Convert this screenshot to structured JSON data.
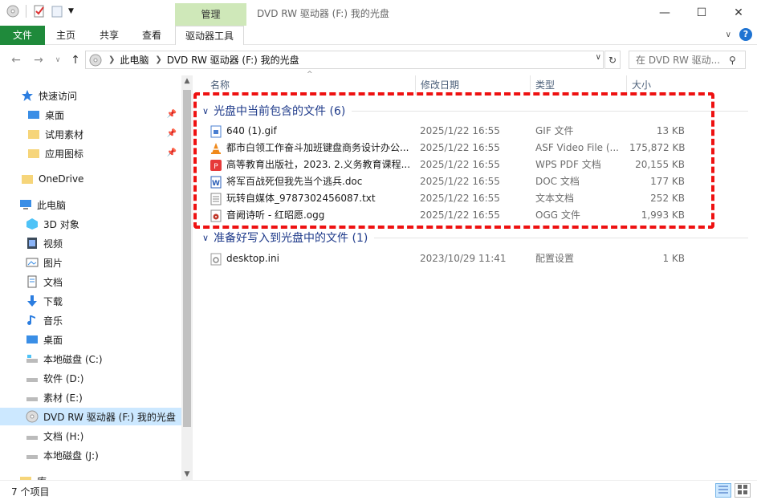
{
  "window": {
    "title": "DVD RW 驱动器 (F:) 我的光盘",
    "context_tab": "管理"
  },
  "ribbon": {
    "tabs": [
      {
        "label": "文件"
      },
      {
        "label": "主页"
      },
      {
        "label": "共享"
      },
      {
        "label": "查看"
      },
      {
        "label": "驱动器工具"
      }
    ]
  },
  "address": {
    "crumbs": [
      "此电脑",
      "DVD RW 驱动器 (F:) 我的光盘"
    ],
    "search_placeholder": "在 DVD RW 驱动..."
  },
  "sidebar": {
    "items": [
      {
        "label": "快速访问",
        "icon": "star-icon"
      },
      {
        "label": "桌面",
        "icon": "desktop-icon",
        "pinned": true
      },
      {
        "label": "试用素材",
        "icon": "folder-icon",
        "pinned": true
      },
      {
        "label": "应用图标",
        "icon": "folder-icon",
        "pinned": true
      },
      {
        "label": "OneDrive",
        "icon": "folder-icon"
      },
      {
        "label": "此电脑",
        "icon": "computer-icon"
      },
      {
        "label": "3D 对象",
        "icon": "cube-icon"
      },
      {
        "label": "视频",
        "icon": "video-icon"
      },
      {
        "label": "图片",
        "icon": "pictures-icon"
      },
      {
        "label": "文档",
        "icon": "document-icon"
      },
      {
        "label": "下载",
        "icon": "download-icon"
      },
      {
        "label": "音乐",
        "icon": "music-icon"
      },
      {
        "label": "桌面",
        "icon": "desktop-icon"
      },
      {
        "label": "本地磁盘 (C:)",
        "icon": "drive-icon"
      },
      {
        "label": "软件 (D:)",
        "icon": "drive-icon"
      },
      {
        "label": "素材 (E:)",
        "icon": "drive-icon"
      },
      {
        "label": "DVD RW 驱动器 (F:) 我的光盘",
        "icon": "disc-icon",
        "selected": true
      },
      {
        "label": "文档 (H:)",
        "icon": "drive-icon"
      },
      {
        "label": "本地磁盘 (J:)",
        "icon": "drive-icon"
      },
      {
        "label": "库",
        "icon": "library-icon"
      }
    ]
  },
  "columns": {
    "name": "名称",
    "date": "修改日期",
    "type": "类型",
    "size": "大小"
  },
  "groups": [
    {
      "title": "光盘中当前包含的文件 (6)",
      "files": [
        {
          "name": "640 (1).gif",
          "date": "2025/1/22 16:55",
          "type": "GIF 文件",
          "size": "13 KB",
          "icon": "gif-file-icon"
        },
        {
          "name": "都市白领工作奋斗加班键盘商务设计办公...",
          "date": "2025/1/22 16:55",
          "type": "ASF Video File (...",
          "size": "175,872 KB",
          "icon": "vlc-cone-icon"
        },
        {
          "name": "高等教育出版社，2023. 2.义务教育课程...",
          "date": "2025/1/22 16:55",
          "type": "WPS PDF 文档",
          "size": "20,155 KB",
          "icon": "pdf-file-icon"
        },
        {
          "name": "将军百战死但我先当个逃兵.doc",
          "date": "2025/1/22 16:55",
          "type": "DOC 文档",
          "size": "177 KB",
          "icon": "word-file-icon"
        },
        {
          "name": "玩转自媒体_9787302456087.txt",
          "date": "2025/1/22 16:55",
          "type": "文本文档",
          "size": "252 KB",
          "icon": "text-file-icon"
        },
        {
          "name": "音阙诗听 - 红昭愿.ogg",
          "date": "2025/1/22 16:55",
          "type": "OGG 文件",
          "size": "1,993 KB",
          "icon": "audio-file-icon"
        }
      ]
    },
    {
      "title": "准备好写入到光盘中的文件 (1)",
      "files": [
        {
          "name": "desktop.ini",
          "date": "2023/10/29 11:41",
          "type": "配置设置",
          "size": "1 KB",
          "icon": "settings-file-icon"
        }
      ]
    }
  ],
  "status": {
    "item_count": "7 个项目"
  },
  "colors": {
    "file_tab": "#1f8a3b",
    "context_tab": "#cfe8b9",
    "group_title": "#1e3a8a",
    "selection": "#cce8ff",
    "highlight": "#ee1111"
  }
}
